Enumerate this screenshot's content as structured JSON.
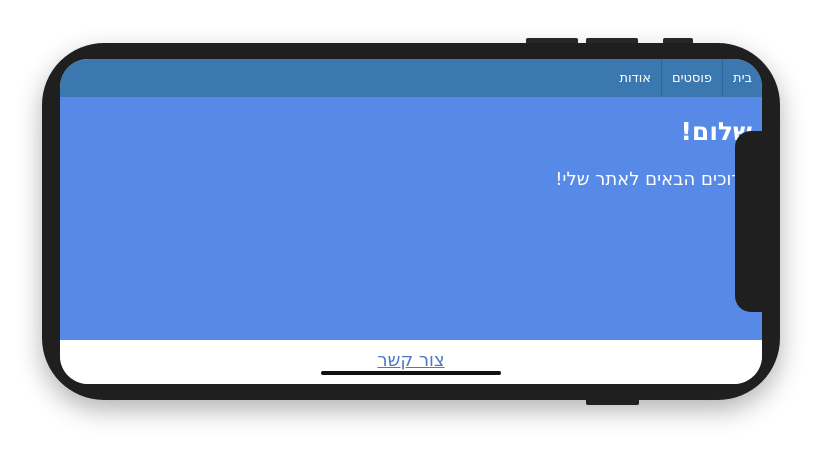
{
  "nav": {
    "items": [
      {
        "label": "בית"
      },
      {
        "label": "פוסטים"
      },
      {
        "label": "אודות"
      }
    ]
  },
  "hero": {
    "title": "שלום!",
    "subtitle": "ברוכים הבאים לאתר שלי!"
  },
  "footer": {
    "contact_label": "צור קשר"
  },
  "colors": {
    "navbar": "#3c78b0",
    "hero": "#5789e7",
    "link": "#4a78c8",
    "device_frame": "#1f1f1f"
  }
}
